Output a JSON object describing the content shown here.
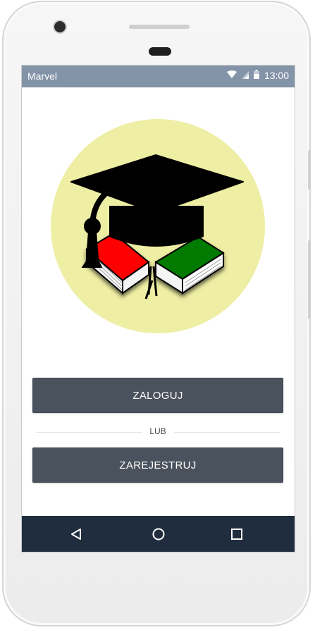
{
  "status_bar": {
    "carrier": "Marvel",
    "time": "13:00",
    "background_color": "#8393a8",
    "icons": [
      "wifi-icon",
      "signal-icon",
      "battery-icon"
    ]
  },
  "logo": {
    "description_icon": "graduation-cap-books-logo",
    "circle_color": "#eeeea4",
    "book_colors": [
      "#ff0000",
      "#007a00"
    ]
  },
  "login_button": {
    "label": "ZALOGUJ"
  },
  "divider": {
    "text": "LUB"
  },
  "register_button": {
    "label": "ZAREJESTRUJ"
  },
  "nav_bar": {
    "background_color": "#1f2d3e",
    "buttons": [
      "back-icon",
      "home-icon",
      "recents-icon"
    ]
  },
  "colors": {
    "button_bg": "#4a525d"
  }
}
